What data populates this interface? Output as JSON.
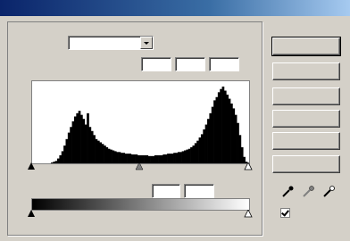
{
  "titlebar": {
    "title": ""
  },
  "channel": {
    "label": "",
    "value": ""
  },
  "input_levels": {
    "label": "",
    "black": "",
    "gamma": "",
    "white": ""
  },
  "output_levels": {
    "label": "",
    "black": "",
    "white": ""
  },
  "histogram": {
    "bins": [
      0,
      0,
      0,
      0,
      0,
      0,
      0,
      0,
      1,
      2,
      3,
      6,
      10,
      15,
      22,
      30,
      38,
      45,
      52,
      58,
      62,
      65,
      60,
      55,
      48,
      62,
      45,
      40,
      35,
      30,
      28,
      26,
      24,
      22,
      20,
      18,
      17,
      16,
      15,
      14,
      14,
      13,
      13,
      12,
      12,
      12,
      11,
      11,
      11,
      10,
      10,
      10,
      10,
      10,
      9,
      9,
      9,
      10,
      10,
      10,
      10,
      11,
      11,
      12,
      12,
      12,
      13,
      13,
      14,
      14,
      15,
      16,
      17,
      18,
      20,
      22,
      25,
      28,
      32,
      36,
      42,
      48,
      55,
      62,
      70,
      78,
      82,
      88,
      92,
      95,
      90,
      85,
      80,
      74,
      68,
      60,
      50,
      35,
      20,
      8,
      2
    ]
  },
  "buttons": {
    "ok": "",
    "cancel": "",
    "load": "",
    "save": "",
    "auto": "",
    "options": ""
  },
  "preview": {
    "label": "",
    "checked": true
  },
  "colors": {
    "title_start": "#0a246a",
    "title_end": "#a6caf0",
    "face": "#d4d0c8"
  }
}
